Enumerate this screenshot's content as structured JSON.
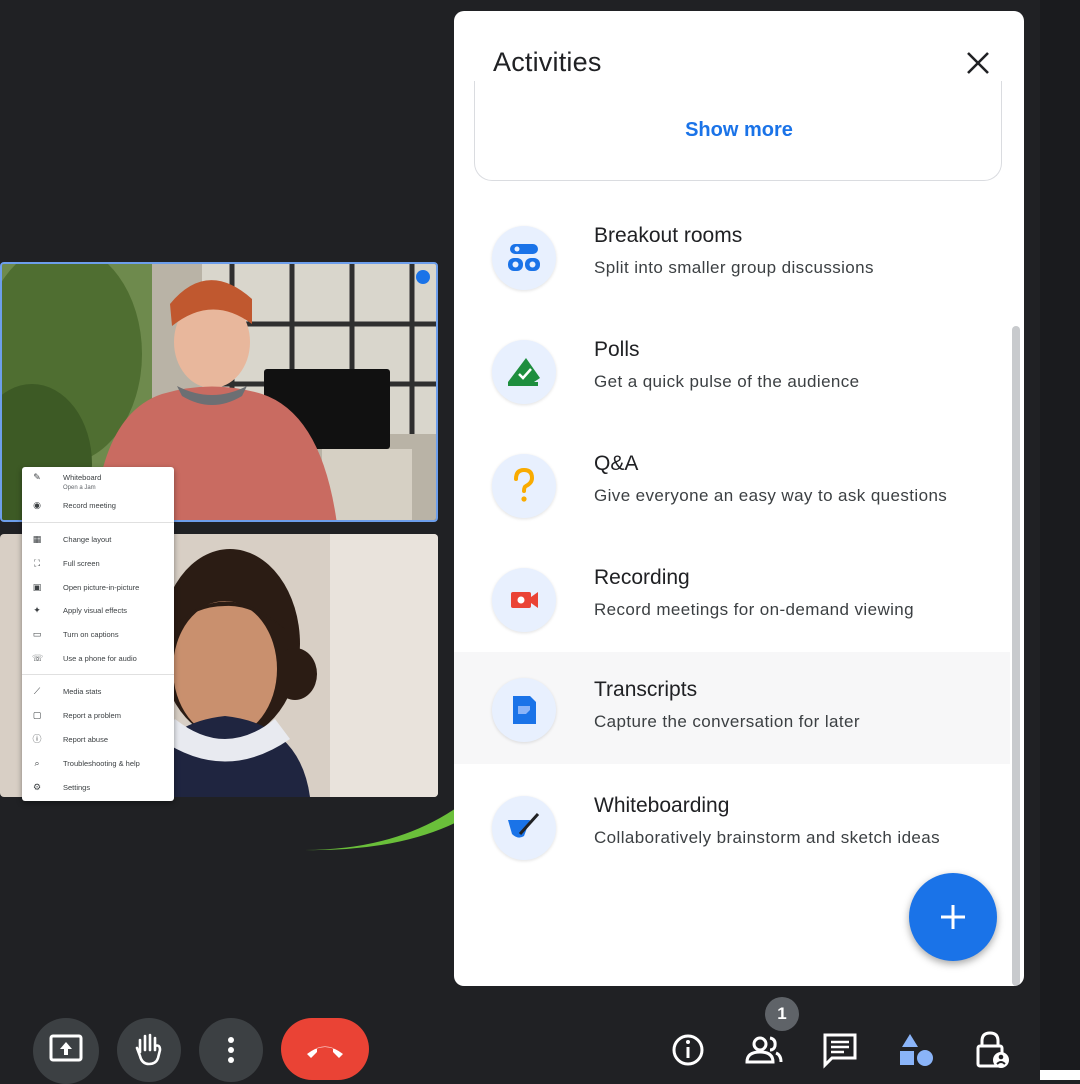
{
  "colors": {
    "background": "#202124",
    "accent": "#1a73e8",
    "hangup": "#ea4335",
    "arrow": "#6abf3a"
  },
  "menu": {
    "items": [
      {
        "label": "Whiteboard",
        "sub": "Open a Jam",
        "icon": "pencil-icon"
      },
      {
        "label": "Record meeting",
        "icon": "record-icon"
      },
      {
        "label": "Change layout",
        "icon": "layout-icon"
      },
      {
        "label": "Full screen",
        "icon": "fullscreen-icon"
      },
      {
        "label": "Open picture-in-picture",
        "icon": "pip-icon"
      },
      {
        "label": "Apply visual effects",
        "icon": "sparkle-icon"
      },
      {
        "label": "Turn on captions",
        "icon": "captions-icon"
      },
      {
        "label": "Use a phone for audio",
        "icon": "phone-icon"
      },
      {
        "label": "Media stats",
        "icon": "chart-icon"
      },
      {
        "label": "Report a problem",
        "icon": "report-icon"
      },
      {
        "label": "Report abuse",
        "icon": "alert-icon"
      },
      {
        "label": "Troubleshooting & help",
        "icon": "help-icon"
      },
      {
        "label": "Settings",
        "icon": "gear-icon"
      }
    ]
  },
  "panel": {
    "title": "Activities",
    "show_more": "Show more",
    "activities": [
      {
        "title": "Breakout rooms",
        "desc": "Split into smaller group discussions",
        "icon": "breakout-icon"
      },
      {
        "title": "Polls",
        "desc": "Get a quick pulse of the audience",
        "icon": "poll-icon"
      },
      {
        "title": "Q&A",
        "desc": "Give everyone an easy way to ask questions",
        "icon": "question-icon"
      },
      {
        "title": "Recording",
        "desc": "Record meetings for on-demand viewing",
        "icon": "recording-icon"
      },
      {
        "title": "Transcripts",
        "desc": "Capture the conversation for later",
        "icon": "transcript-icon"
      },
      {
        "title": "Whiteboarding",
        "desc": "Collaboratively brainstorm and sketch ideas",
        "icon": "whiteboard-icon"
      }
    ]
  },
  "toolbar": {
    "people_count": "1"
  }
}
